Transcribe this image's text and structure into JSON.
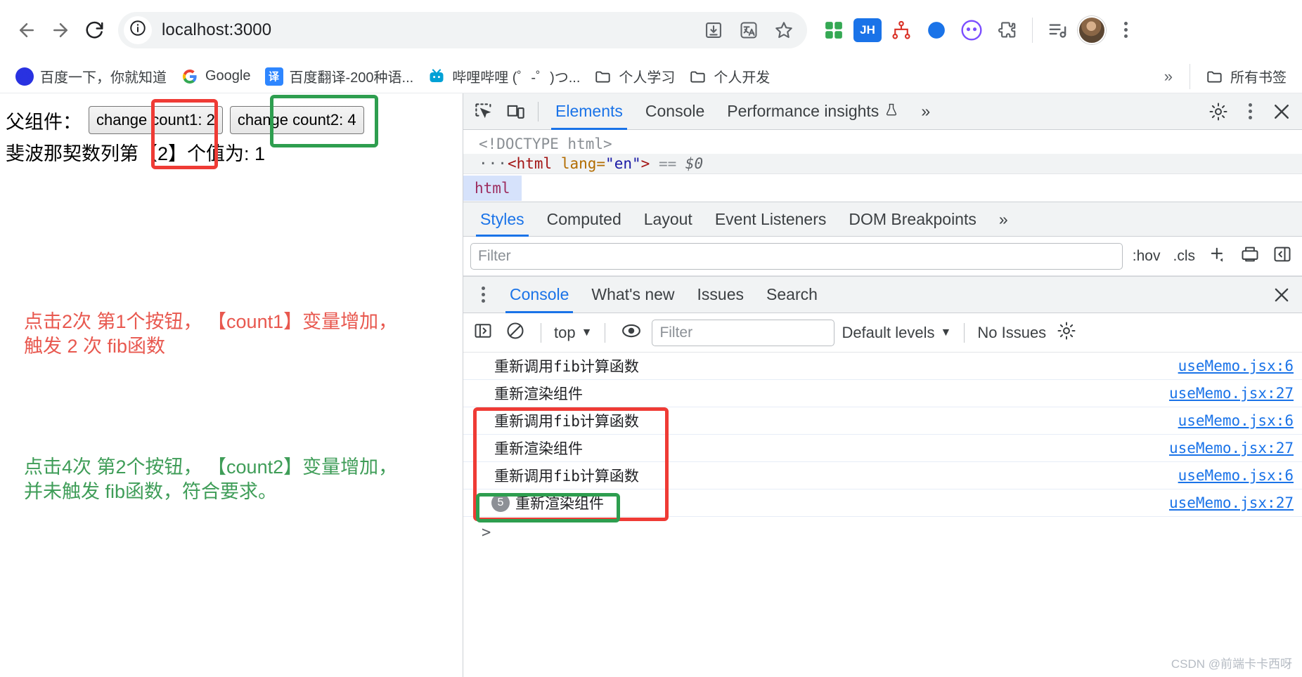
{
  "browser": {
    "back_icon": "back-arrow-icon",
    "forward_icon": "forward-arrow-icon",
    "reload_icon": "reload-icon",
    "url": "localhost:3000",
    "site_info_icon": "info-circle-icon",
    "omnibox_actions": [
      {
        "name": "install-app-icon",
        "glyph": "install"
      },
      {
        "name": "translate-icon",
        "glyph": "translate"
      },
      {
        "name": "bookmark-star-icon",
        "glyph": "star"
      }
    ],
    "extensions": [
      {
        "name": "qr-grid-extension-icon",
        "label": "",
        "color": "#2bb673"
      },
      {
        "name": "jh-extension-icon",
        "label": "JH",
        "color": "#1a73e8"
      },
      {
        "name": "sitemap-extension-icon",
        "label": "",
        "color": "#e8710a"
      },
      {
        "name": "blue-dot-extension-icon",
        "label": "",
        "color": "#1a73e8"
      },
      {
        "name": "smiley-extension-icon",
        "label": "",
        "color": "#7b4dff"
      },
      {
        "name": "puzzle-extensions-icon",
        "label": "",
        "color": "#5f6368"
      }
    ],
    "media_icon": "media-playlist-icon",
    "avatar_name": "profile-avatar",
    "menu_icon": "three-dot-menu-icon"
  },
  "bookmarks": {
    "items": [
      {
        "label": "百度一下，你就知道",
        "favicon": "baidu-favicon",
        "glyph": "百"
      },
      {
        "label": "Google",
        "favicon": "google-favicon",
        "glyph": "G"
      },
      {
        "label": "百度翻译-200种语...",
        "favicon": "baidu-fanyi-favicon",
        "glyph": "译"
      },
      {
        "label": "哔哩哔哩 (゜-゜)つ...",
        "favicon": "bilibili-favicon",
        "glyph": "tv"
      },
      {
        "label": "个人学习",
        "favicon": "folder-icon",
        "glyph": "folder"
      },
      {
        "label": "个人开发",
        "favicon": "folder-icon",
        "glyph": "folder"
      }
    ],
    "overflow_label": "»",
    "all_bookmarks_label": "所有书签",
    "all_bookmarks_icon": "folder-icon"
  },
  "page": {
    "label": "父组件：",
    "buttons": [
      {
        "label": "change count1: 2"
      },
      {
        "label": "change count2: 4"
      }
    ],
    "fib_text": "斐波那契数列第【2】个值为: 1",
    "annotations": [
      {
        "name": "annotation-red",
        "color": "#e8584f",
        "text": "点击2次 第1个按钮， 【count1】变量增加，\n触发 2 次 fib函数"
      },
      {
        "name": "annotation-green",
        "color": "#3f9d58",
        "text": "点击4次 第2个按钮， 【count2】变量增加，\n并未触发 fib函数，符合要求。"
      }
    ]
  },
  "devtools": {
    "toolbar_icons": [
      {
        "name": "inspect-element-icon"
      },
      {
        "name": "device-toolbar-icon"
      }
    ],
    "tabs": [
      {
        "label": "Elements",
        "active": true
      },
      {
        "label": "Console",
        "active": false
      },
      {
        "label": "Performance insights",
        "active": false,
        "suffix_icon": "flask-icon"
      }
    ],
    "more_tabs_label": "»",
    "settings_icon": "gear-icon",
    "kebab_icon": "three-dot-menu-icon",
    "close_icon": "close-icon",
    "dom": {
      "doctype": "<!DOCTYPE html>",
      "selected_line": {
        "dots": "···",
        "open": "<html",
        "attr_name": "lang",
        "attr_value": "\"en\"",
        "close": ">",
        "equals": "==",
        "dollar": "$0"
      }
    },
    "breadcrumb": "html",
    "styles_tabs": [
      {
        "label": "Styles",
        "active": true
      },
      {
        "label": "Computed",
        "active": false
      },
      {
        "label": "Layout",
        "active": false
      },
      {
        "label": "Event Listeners",
        "active": false
      },
      {
        "label": "DOM Breakpoints",
        "active": false
      }
    ],
    "styles_more_label": "»",
    "styles_filter_placeholder": "Filter",
    "styles_filter_value": "",
    "hov_label": ":hov",
    "cls_label": ".cls",
    "new_style_rule_icon": "plus-icon",
    "print_icon": "computed-style-icon",
    "sidebar_toggle_icon": "panel-toggle-icon"
  },
  "drawer": {
    "kebab_icon": "three-dot-menu-icon",
    "tabs": [
      {
        "label": "Console",
        "active": true
      },
      {
        "label": "What's new",
        "active": false
      },
      {
        "label": "Issues",
        "active": false
      },
      {
        "label": "Search",
        "active": false
      }
    ],
    "close_icon": "close-icon",
    "toolbar": {
      "sidebar_icon": "console-sidebar-icon",
      "clear_icon": "clear-console-icon",
      "context_label": "top",
      "context_caret": "▼",
      "eye_icon": "live-expression-icon",
      "filter_placeholder": "Filter",
      "filter_value": "",
      "levels_label": "Default levels",
      "levels_caret": "▼",
      "issues_label": "No Issues",
      "settings_icon": "console-settings-icon"
    },
    "logs": [
      {
        "message": "重新调用fib计算函数",
        "source": "useMemo.jsx:6",
        "badge": ""
      },
      {
        "message": "重新渲染组件",
        "source": "useMemo.jsx:27",
        "badge": ""
      },
      {
        "message": "重新调用fib计算函数",
        "source": "useMemo.jsx:6",
        "badge": ""
      },
      {
        "message": "重新渲染组件",
        "source": "useMemo.jsx:27",
        "badge": ""
      },
      {
        "message": "重新调用fib计算函数",
        "source": "useMemo.jsx:6",
        "badge": ""
      },
      {
        "message": "重新渲染组件",
        "source": "useMemo.jsx:27",
        "badge": "5"
      }
    ],
    "prompt": ">"
  },
  "watermark": "CSDN @前端卡卡西呀",
  "colors": {
    "accent_blue": "#1a73e8",
    "highlight_red": "#ef3b35",
    "highlight_green": "#2e9e4f",
    "annotation_red": "#e8584f",
    "annotation_green": "#3f9d58"
  }
}
